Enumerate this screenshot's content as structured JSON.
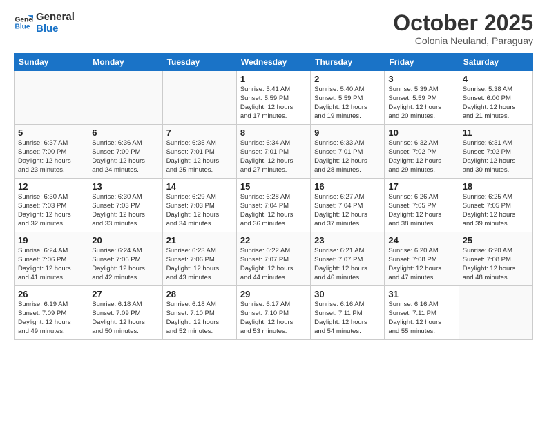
{
  "logo": {
    "line1": "General",
    "line2": "Blue"
  },
  "header": {
    "month": "October 2025",
    "location": "Colonia Neuland, Paraguay"
  },
  "days_of_week": [
    "Sunday",
    "Monday",
    "Tuesday",
    "Wednesday",
    "Thursday",
    "Friday",
    "Saturday"
  ],
  "weeks": [
    [
      {
        "day": "",
        "info": ""
      },
      {
        "day": "",
        "info": ""
      },
      {
        "day": "",
        "info": ""
      },
      {
        "day": "1",
        "info": "Sunrise: 5:41 AM\nSunset: 5:59 PM\nDaylight: 12 hours\nand 17 minutes."
      },
      {
        "day": "2",
        "info": "Sunrise: 5:40 AM\nSunset: 5:59 PM\nDaylight: 12 hours\nand 19 minutes."
      },
      {
        "day": "3",
        "info": "Sunrise: 5:39 AM\nSunset: 5:59 PM\nDaylight: 12 hours\nand 20 minutes."
      },
      {
        "day": "4",
        "info": "Sunrise: 5:38 AM\nSunset: 6:00 PM\nDaylight: 12 hours\nand 21 minutes."
      }
    ],
    [
      {
        "day": "5",
        "info": "Sunrise: 6:37 AM\nSunset: 7:00 PM\nDaylight: 12 hours\nand 23 minutes."
      },
      {
        "day": "6",
        "info": "Sunrise: 6:36 AM\nSunset: 7:00 PM\nDaylight: 12 hours\nand 24 minutes."
      },
      {
        "day": "7",
        "info": "Sunrise: 6:35 AM\nSunset: 7:01 PM\nDaylight: 12 hours\nand 25 minutes."
      },
      {
        "day": "8",
        "info": "Sunrise: 6:34 AM\nSunset: 7:01 PM\nDaylight: 12 hours\nand 27 minutes."
      },
      {
        "day": "9",
        "info": "Sunrise: 6:33 AM\nSunset: 7:01 PM\nDaylight: 12 hours\nand 28 minutes."
      },
      {
        "day": "10",
        "info": "Sunrise: 6:32 AM\nSunset: 7:02 PM\nDaylight: 12 hours\nand 29 minutes."
      },
      {
        "day": "11",
        "info": "Sunrise: 6:31 AM\nSunset: 7:02 PM\nDaylight: 12 hours\nand 30 minutes."
      }
    ],
    [
      {
        "day": "12",
        "info": "Sunrise: 6:30 AM\nSunset: 7:03 PM\nDaylight: 12 hours\nand 32 minutes."
      },
      {
        "day": "13",
        "info": "Sunrise: 6:30 AM\nSunset: 7:03 PM\nDaylight: 12 hours\nand 33 minutes."
      },
      {
        "day": "14",
        "info": "Sunrise: 6:29 AM\nSunset: 7:03 PM\nDaylight: 12 hours\nand 34 minutes."
      },
      {
        "day": "15",
        "info": "Sunrise: 6:28 AM\nSunset: 7:04 PM\nDaylight: 12 hours\nand 36 minutes."
      },
      {
        "day": "16",
        "info": "Sunrise: 6:27 AM\nSunset: 7:04 PM\nDaylight: 12 hours\nand 37 minutes."
      },
      {
        "day": "17",
        "info": "Sunrise: 6:26 AM\nSunset: 7:05 PM\nDaylight: 12 hours\nand 38 minutes."
      },
      {
        "day": "18",
        "info": "Sunrise: 6:25 AM\nSunset: 7:05 PM\nDaylight: 12 hours\nand 39 minutes."
      }
    ],
    [
      {
        "day": "19",
        "info": "Sunrise: 6:24 AM\nSunset: 7:06 PM\nDaylight: 12 hours\nand 41 minutes."
      },
      {
        "day": "20",
        "info": "Sunrise: 6:24 AM\nSunset: 7:06 PM\nDaylight: 12 hours\nand 42 minutes."
      },
      {
        "day": "21",
        "info": "Sunrise: 6:23 AM\nSunset: 7:06 PM\nDaylight: 12 hours\nand 43 minutes."
      },
      {
        "day": "22",
        "info": "Sunrise: 6:22 AM\nSunset: 7:07 PM\nDaylight: 12 hours\nand 44 minutes."
      },
      {
        "day": "23",
        "info": "Sunrise: 6:21 AM\nSunset: 7:07 PM\nDaylight: 12 hours\nand 46 minutes."
      },
      {
        "day": "24",
        "info": "Sunrise: 6:20 AM\nSunset: 7:08 PM\nDaylight: 12 hours\nand 47 minutes."
      },
      {
        "day": "25",
        "info": "Sunrise: 6:20 AM\nSunset: 7:08 PM\nDaylight: 12 hours\nand 48 minutes."
      }
    ],
    [
      {
        "day": "26",
        "info": "Sunrise: 6:19 AM\nSunset: 7:09 PM\nDaylight: 12 hours\nand 49 minutes."
      },
      {
        "day": "27",
        "info": "Sunrise: 6:18 AM\nSunset: 7:09 PM\nDaylight: 12 hours\nand 50 minutes."
      },
      {
        "day": "28",
        "info": "Sunrise: 6:18 AM\nSunset: 7:10 PM\nDaylight: 12 hours\nand 52 minutes."
      },
      {
        "day": "29",
        "info": "Sunrise: 6:17 AM\nSunset: 7:10 PM\nDaylight: 12 hours\nand 53 minutes."
      },
      {
        "day": "30",
        "info": "Sunrise: 6:16 AM\nSunset: 7:11 PM\nDaylight: 12 hours\nand 54 minutes."
      },
      {
        "day": "31",
        "info": "Sunrise: 6:16 AM\nSunset: 7:11 PM\nDaylight: 12 hours\nand 55 minutes."
      },
      {
        "day": "",
        "info": ""
      }
    ]
  ]
}
